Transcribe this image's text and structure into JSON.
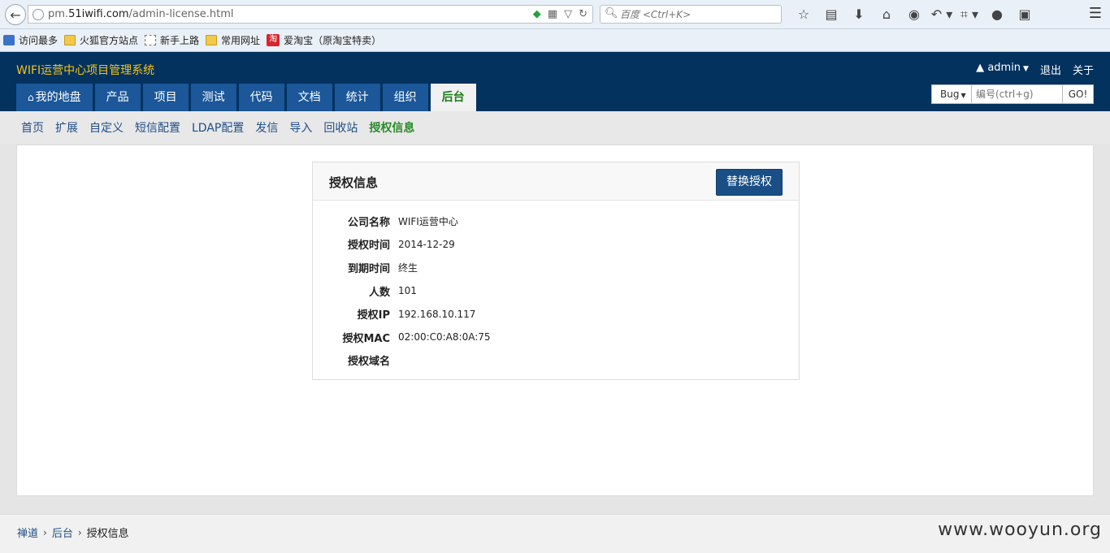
{
  "browser": {
    "url_prefix": "pm.",
    "url_domain": "51iwifi.com",
    "url_path": "/admin-license.html",
    "search_placeholder": "百度 <Ctrl+K>"
  },
  "bookmarks": [
    {
      "label": "访问最多",
      "icon": "reader-icon"
    },
    {
      "label": "火狐官方站点",
      "icon": "folder-icon"
    },
    {
      "label": "新手上路",
      "icon": "page-icon"
    },
    {
      "label": "常用网址",
      "icon": "folder-icon"
    },
    {
      "label": "爱淘宝（原淘宝特卖）",
      "icon": "taobao-icon",
      "icon_text": "淘"
    }
  ],
  "app": {
    "title": "WIFI运营中心项目管理系统",
    "user": "admin",
    "logout": "退出",
    "about": "关于"
  },
  "main_nav": [
    {
      "label": "我的地盘"
    },
    {
      "label": "产品"
    },
    {
      "label": "项目"
    },
    {
      "label": "测试"
    },
    {
      "label": "代码"
    },
    {
      "label": "文档"
    },
    {
      "label": "统计"
    },
    {
      "label": "组织"
    },
    {
      "label": "后台",
      "active": true
    }
  ],
  "quick_search": {
    "type": "Bug",
    "placeholder": "编号(ctrl+g)",
    "go": "GO!"
  },
  "sub_nav": [
    {
      "label": "首页"
    },
    {
      "label": "扩展"
    },
    {
      "label": "自定义"
    },
    {
      "label": "短信配置"
    },
    {
      "label": "LDAP配置"
    },
    {
      "label": "发信"
    },
    {
      "label": "导入"
    },
    {
      "label": "回收站"
    },
    {
      "label": "授权信息",
      "active": true
    }
  ],
  "license_panel": {
    "title": "授权信息",
    "replace_button": "替换授权",
    "rows": [
      {
        "label": "公司名称",
        "value": "WIFI运营中心"
      },
      {
        "label": "授权时间",
        "value": "2014-12-29"
      },
      {
        "label": "到期时间",
        "value": "终生"
      },
      {
        "label": "人数",
        "value": "101"
      },
      {
        "label": "授权IP",
        "value": "192.168.10.117"
      },
      {
        "label": "授权MAC",
        "value": "02:00:C0:A8:0A:75"
      },
      {
        "label": "授权域名",
        "value": ""
      }
    ]
  },
  "breadcrumb": {
    "items": [
      "禅道",
      "后台"
    ],
    "current": "授权信息"
  },
  "watermark": "www.wooyun.org"
}
